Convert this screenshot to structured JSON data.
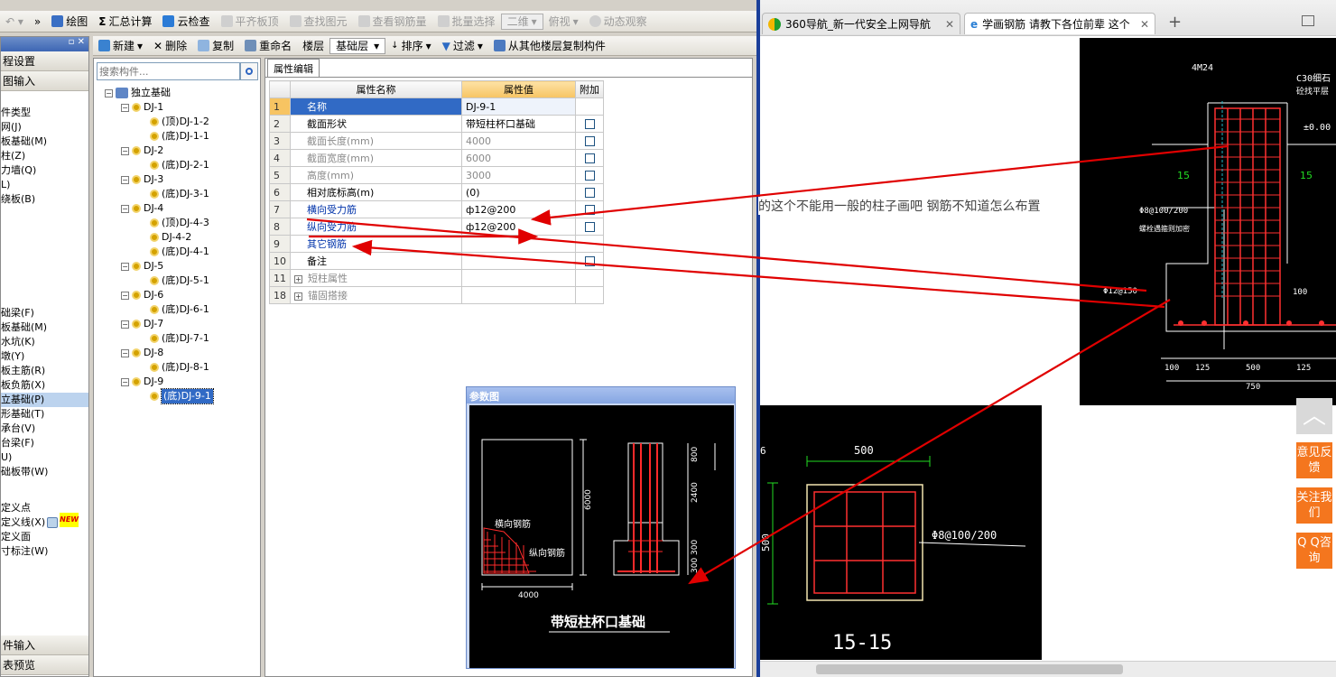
{
  "app": {
    "toolbar1": {
      "draw": "绘图",
      "sum": "汇总计算",
      "cloud_check": "云检查",
      "flat_board": "平齐板顶",
      "find_elem": "查找图元",
      "view_rebar": "查看钢筋量",
      "batch_select": "批量选择",
      "view_mode": "二维",
      "view_angle": "俯视",
      "dynamic": "动态观察",
      "overflow": "»"
    },
    "toolbar2": {
      "new": "新建",
      "delete": "删除",
      "copy": "复制",
      "rename": "重命名",
      "floor_label": "楼层",
      "floor_value": "基础层",
      "sort": "排序",
      "filter": "过滤",
      "copy_from_floor": "从其他楼层复制构件"
    },
    "left_panel": {
      "tab1": "程设置",
      "tab2": "图输入",
      "items_top": [
        "件类型",
        "网(J)",
        "板基础(M)",
        "柱(Z)",
        "力墙(Q)",
        "L)",
        "绕板(B)"
      ],
      "items_bottom": [
        "础梁(F)",
        "板基础(M)",
        "水坑(K)",
        "墩(Y)",
        "板主筋(R)",
        "板负筋(X)",
        "立基础(P)",
        "形基础(T)",
        "承台(V)",
        "台梁(F)",
        "U)",
        "础板带(W)"
      ],
      "items_define": [
        "定义点",
        "定义线(X)",
        "定义面",
        "寸标注(W)"
      ],
      "new_badge": "NEW",
      "bottom1": "件输入",
      "bottom2": "表预览"
    },
    "search": {
      "placeholder": "搜索构件..."
    },
    "tree": {
      "root": "独立基础",
      "nodes": [
        {
          "label": "DJ-1",
          "children": [
            "(顶)DJ-1-2",
            "(底)DJ-1-1"
          ]
        },
        {
          "label": "DJ-2",
          "children": [
            "(底)DJ-2-1"
          ]
        },
        {
          "label": "DJ-3",
          "children": [
            "(底)DJ-3-1"
          ]
        },
        {
          "label": "DJ-4",
          "children": [
            "(顶)DJ-4-3",
            "DJ-4-2",
            "(底)DJ-4-1"
          ]
        },
        {
          "label": "DJ-5",
          "children": [
            "(底)DJ-5-1"
          ]
        },
        {
          "label": "DJ-6",
          "children": [
            "(底)DJ-6-1"
          ]
        },
        {
          "label": "DJ-7",
          "children": [
            "(底)DJ-7-1"
          ]
        },
        {
          "label": "DJ-8",
          "children": [
            "(底)DJ-8-1"
          ]
        },
        {
          "label": "DJ-9",
          "children": [
            "(底)DJ-9-1"
          ]
        }
      ]
    },
    "props": {
      "tab": "属性编辑",
      "headers": [
        "属性名称",
        "属性值",
        "附加"
      ],
      "rows": [
        {
          "n": "1",
          "name": "名称",
          "value": "DJ-9-1",
          "check": false
        },
        {
          "n": "2",
          "name": "截面形状",
          "value": "带短柱杯口基础",
          "check": true
        },
        {
          "n": "3",
          "name": "截面长度(mm)",
          "value": "4000",
          "check": true
        },
        {
          "n": "4",
          "name": "截面宽度(mm)",
          "value": "6000",
          "check": true
        },
        {
          "n": "5",
          "name": "高度(mm)",
          "value": "3000",
          "check": true
        },
        {
          "n": "6",
          "name": "相对底标高(m)",
          "value": "(0)",
          "check": true
        },
        {
          "n": "7",
          "name": "横向受力筋",
          "value": "ф12@200",
          "check": true
        },
        {
          "n": "8",
          "name": "纵向受力筋",
          "value": "ф12@200",
          "check": true
        },
        {
          "n": "9",
          "name": "其它钢筋",
          "value": "",
          "check": false
        },
        {
          "n": "10",
          "name": "备注",
          "value": "",
          "check": true
        },
        {
          "n": "11",
          "name": "短柱属性",
          "value": "",
          "check": false
        },
        {
          "n": "18",
          "name": "锚固搭接",
          "value": "",
          "check": false
        }
      ]
    },
    "param_fig": {
      "title": "参数图",
      "label_h": "横向钢筋",
      "label_v": "纵向钢筋",
      "dim_6000": "6000",
      "dim_4000": "4000",
      "dim_800": "800",
      "dim_2400": "2400",
      "dim_300a": "300",
      "dim_300b": "300",
      "caption": "带短柱杯口基础"
    }
  },
  "browser": {
    "tab1": "360导航_新一代安全上网导航",
    "tab2": "学画钢筋 请教下各位前辈 这个",
    "new_tab": "+",
    "question": "的这个不能用一般的柱子画吧 钢筋不知道怎么布置",
    "dwg_top": {
      "l_4m24": "4M24",
      "l_c30": "C30细石",
      "l_c30b": "砼找平层",
      "l_pm": "±0.00",
      "l_15a": "15",
      "l_15b": "15",
      "l_phi8": "Φ8@100/200",
      "l_phi8b": "螺栓遇箍则加密",
      "l_phi12": "Φ12@150",
      "l_100": "100",
      "d1": "100",
      "d2": "125",
      "d3": "500",
      "d4": "125",
      "d_total": "750"
    },
    "dwg_bottom": {
      "w": "500",
      "h": "500",
      "rebar": "Φ8@100/200",
      "section": "15-15",
      "corner": "6"
    },
    "side": {
      "up": "︿",
      "feedback": "意见反馈",
      "follow": "关注我们",
      "qq": "Q Q咨询"
    }
  }
}
